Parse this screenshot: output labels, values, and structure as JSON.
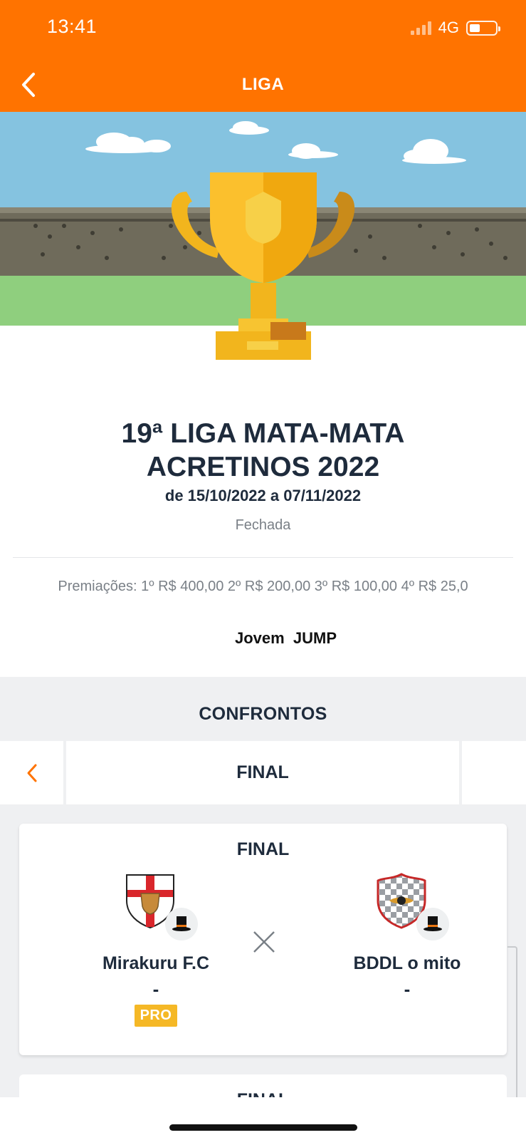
{
  "status_bar": {
    "time": "13:41",
    "network": "4G"
  },
  "header": {
    "title": "LIGA"
  },
  "league": {
    "title_line1": "19ª LIGA MATA-MATA",
    "title_line2": "ACRETINOS 2022",
    "dates": "de 15/10/2022 a 07/11/2022",
    "status": "Fechada",
    "prizes": "Premiações: 1º R$ 400,00 2º R$ 200,00 3º R$ 100,00 4º R$ 25,0",
    "sponsor": "Jovem  JUMP"
  },
  "matchups": {
    "section_title": "CONFRONTOS",
    "round_label": "FINAL",
    "match": {
      "title": "FINAL",
      "home": {
        "name": "Mirakuru F.C",
        "score": "-",
        "badge": "PRO"
      },
      "away": {
        "name": "BDDL o mito",
        "score": "-"
      }
    },
    "next_match_title": "FINAL"
  },
  "colors": {
    "accent": "#ff7300",
    "title": "#1e2b3c",
    "pro_badge": "#f5b826"
  },
  "icons": [
    "back-chevron-icon",
    "trophy-illustration",
    "chevron-left-icon",
    "top-hat-icon",
    "versus-x-icon"
  ]
}
